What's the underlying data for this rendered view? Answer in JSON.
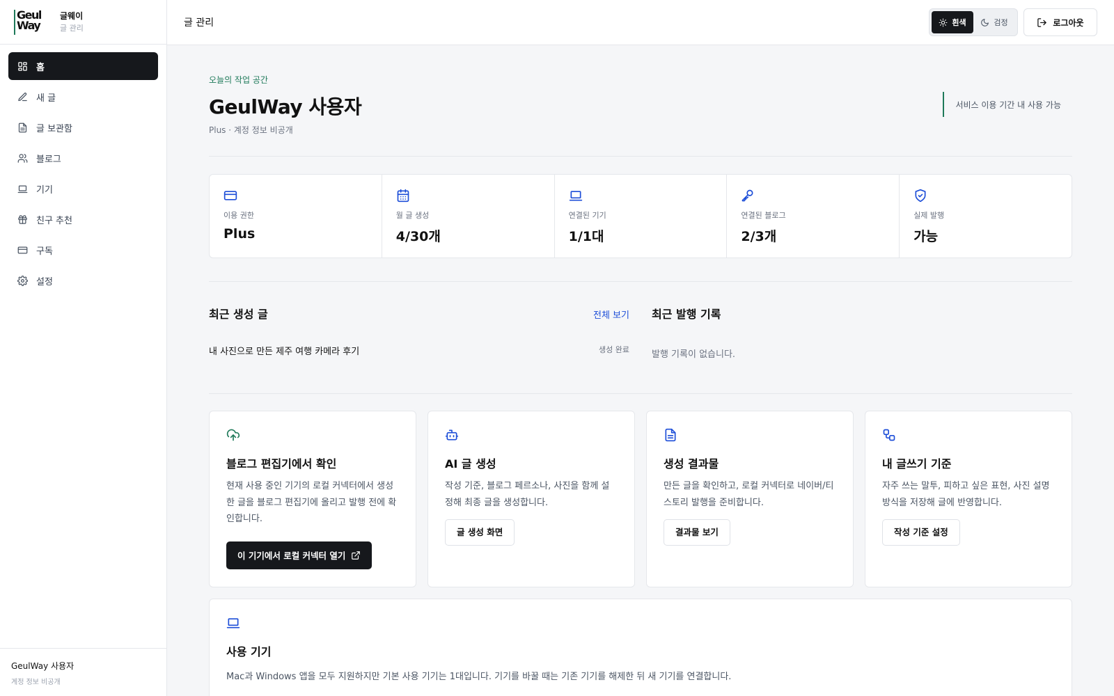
{
  "brand": {
    "logo_line1": "Geul",
    "logo_line2": "Way",
    "name": "글웨이",
    "sub": "글 관리"
  },
  "nav": [
    {
      "label": "홈",
      "icon": "dashboard-icon",
      "active": true
    },
    {
      "label": "새 글",
      "icon": "pencil-icon"
    },
    {
      "label": "글 보관함",
      "icon": "document-icon"
    },
    {
      "label": "블로그",
      "icon": "users-icon"
    },
    {
      "label": "기기",
      "icon": "laptop-icon"
    },
    {
      "label": "친구 추천",
      "icon": "gift-icon"
    },
    {
      "label": "구독",
      "icon": "credit-card-icon"
    },
    {
      "label": "설정",
      "icon": "gear-icon"
    }
  ],
  "sidebar_footer": {
    "name": "GeulWay 사용자",
    "sub": "계정 정보 비공개"
  },
  "topbar": {
    "title": "글 관리",
    "theme_light": "흰색",
    "theme_dark": "검정",
    "logout": "로그아웃"
  },
  "hero": {
    "eyebrow": "오늘의 작업 공간",
    "title": "GeulWay 사용자",
    "sub": "Plus · 계정 정보 비공개",
    "note": "서비스 이용 기간 내 사용 가능"
  },
  "stats": [
    {
      "label": "이용 권한",
      "value": "Plus",
      "icon": "credit-card-icon"
    },
    {
      "label": "월 글 생성",
      "value": "4/30개",
      "icon": "calendar-icon"
    },
    {
      "label": "연결된 기기",
      "value": "1/1대",
      "icon": "laptop-icon"
    },
    {
      "label": "연결된 블로그",
      "value": "2/3개",
      "icon": "key-icon"
    },
    {
      "label": "실제 발행",
      "value": "가능",
      "icon": "shield-check-icon"
    }
  ],
  "recent": {
    "title": "최근 생성 글",
    "see_all": "전체 보기",
    "item_title": "내 사진으로 만든 제주 여행 카메라 후기",
    "item_status": "생성 완료"
  },
  "publish": {
    "title": "최근 발행 기록",
    "empty": "발행 기록이 없습니다."
  },
  "cards": [
    {
      "title": "블로그 편집기에서 확인",
      "desc": "현재 사용 중인 기기의 로컬 커넥터에서 생성한 글을 블로그 편집기에 올리고 발행 전에 확인합니다.",
      "button": "이 기기에서 로컬 커넥터 열기",
      "icon": "cloud-upload-icon",
      "accent": "#1f7a5a"
    },
    {
      "title": "AI 글 생성",
      "desc": "작성 기준, 블로그 페르소나, 사진을 함께 설정해 최종 글을 생성합니다.",
      "button": "글 생성 화면",
      "icon": "robot-icon",
      "accent": "#1d4ed8"
    },
    {
      "title": "생성 결과물",
      "desc": "만든 글을 확인하고, 로컬 커넥터로 네이버/티스토리 발행을 준비합니다.",
      "button": "결과물 보기",
      "icon": "document-icon",
      "accent": "#1d4ed8"
    },
    {
      "title": "내 글쓰기 기준",
      "desc": "자주 쓰는 말투, 피하고 싶은 표현, 사진 설명 방식을 저장해 글에 반영합니다.",
      "button": "작성 기준 설정",
      "icon": "workflow-icon",
      "accent": "#1d4ed8"
    }
  ],
  "device": {
    "title": "사용 기기",
    "desc": "Mac과 Windows 앱을 모두 지원하지만 기본 사용 기기는 1대입니다. 기기를 바꿀 때는 기존 기기를 해제한 뒤 새 기기를 연결합니다."
  }
}
